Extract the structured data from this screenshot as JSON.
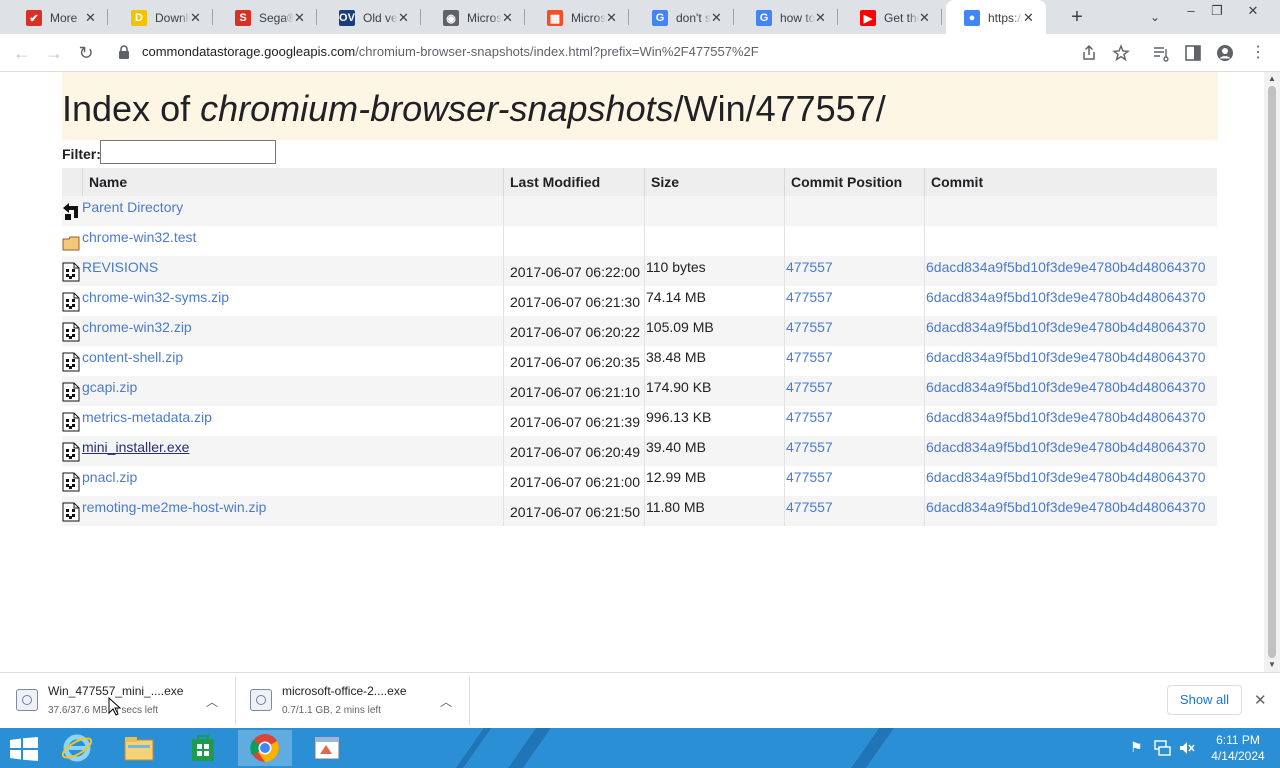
{
  "tabs": [
    {
      "title": "More",
      "favicon_color": "#d93025",
      "favicon_glyph": "✔"
    },
    {
      "title": "Downlo",
      "favicon_color": "#f2c300",
      "favicon_glyph": "D"
    },
    {
      "title": "Sega®",
      "favicon_color": "#d93025",
      "favicon_glyph": "S"
    },
    {
      "title": "Old ver",
      "favicon_color": "#1a3d7c",
      "favicon_glyph": "OV"
    },
    {
      "title": "Micros",
      "favicon_color": "#5f6368",
      "favicon_glyph": "◉"
    },
    {
      "title": "Micros",
      "favicon_color": "#f25022",
      "favicon_glyph": "▦"
    },
    {
      "title": "don't st",
      "favicon_color": "#4285f4",
      "favicon_glyph": "G"
    },
    {
      "title": "how to",
      "favicon_color": "#4285f4",
      "favicon_glyph": "G"
    },
    {
      "title": "Get the",
      "favicon_color": "#ff0000",
      "favicon_glyph": "▶"
    },
    {
      "title": "https://",
      "favicon_color": "#4285f4",
      "favicon_glyph": "●"
    }
  ],
  "window": {
    "minimize": "–",
    "restore": "❐",
    "close": "✕"
  },
  "toolbar": {
    "back": "←",
    "forward": "→",
    "reload": "↻",
    "url_host": "commondatastorage.googleapis.com",
    "url_path": "/chromium-browser-snapshots/index.html?prefix=Win%2F477557%2F"
  },
  "page": {
    "title_prefix": "Index of ",
    "title_italic": "chromium-browser-snapshots",
    "title_suffix": "/Win/477557/",
    "filter_label": "Filter:",
    "filter_value": "",
    "columns": {
      "name": "Name",
      "modified": "Last Modified",
      "size": "Size",
      "position": "Commit Position",
      "commit": "Commit"
    },
    "rows": [
      {
        "icon": "back",
        "name": "Parent Directory",
        "modified": "",
        "size": "",
        "position": "",
        "commit": ""
      },
      {
        "icon": "folder",
        "name": "chrome-win32.test",
        "modified": "",
        "size": "",
        "position": "",
        "commit": ""
      },
      {
        "icon": "binary",
        "name": "REVISIONS",
        "modified": "2017-06-07 06:22:00",
        "size": "110 bytes",
        "position": "477557",
        "commit": "6dacd834a9f5bd10f3de9e4780b4d48064370"
      },
      {
        "icon": "binary",
        "name": "chrome-win32-syms.zip",
        "modified": "2017-06-07 06:21:30",
        "size": "74.14 MB",
        "position": "477557",
        "commit": "6dacd834a9f5bd10f3de9e4780b4d48064370"
      },
      {
        "icon": "binary",
        "name": "chrome-win32.zip",
        "modified": "2017-06-07 06:20:22",
        "size": "105.09 MB",
        "position": "477557",
        "commit": "6dacd834a9f5bd10f3de9e4780b4d48064370"
      },
      {
        "icon": "binary",
        "name": "content-shell.zip",
        "modified": "2017-06-07 06:20:35",
        "size": "38.48 MB",
        "position": "477557",
        "commit": "6dacd834a9f5bd10f3de9e4780b4d48064370"
      },
      {
        "icon": "binary",
        "name": "gcapi.zip",
        "modified": "2017-06-07 06:21:10",
        "size": "174.90 KB",
        "position": "477557",
        "commit": "6dacd834a9f5bd10f3de9e4780b4d48064370"
      },
      {
        "icon": "binary",
        "name": "metrics-metadata.zip",
        "modified": "2017-06-07 06:21:39",
        "size": "996.13 KB",
        "position": "477557",
        "commit": "6dacd834a9f5bd10f3de9e4780b4d48064370"
      },
      {
        "icon": "binary",
        "name": "mini_installer.exe",
        "modified": "2017-06-07 06:20:49",
        "size": "39.40 MB",
        "position": "477557",
        "commit": "6dacd834a9f5bd10f3de9e4780b4d48064370",
        "visited": true
      },
      {
        "icon": "binary",
        "name": "pnacl.zip",
        "modified": "2017-06-07 06:21:00",
        "size": "12.99 MB",
        "position": "477557",
        "commit": "6dacd834a9f5bd10f3de9e4780b4d48064370"
      },
      {
        "icon": "binary",
        "name": "remoting-me2me-host-win.zip",
        "modified": "2017-06-07 06:21:50",
        "size": "11.80 MB",
        "position": "477557",
        "commit": "6dacd834a9f5bd10f3de9e4780b4d48064370"
      }
    ]
  },
  "downloads": {
    "items": [
      {
        "name": "Win_477557_mini_....exe",
        "status": "37.6/37.6 MB, 0 secs left"
      },
      {
        "name": "microsoft-office-2....exe",
        "status": "0.7/1.1 GB, 2 mins left"
      }
    ],
    "show_all": "Show all",
    "close": "✕"
  },
  "taskbar": {
    "clock_time": "6:11 PM",
    "clock_date": "4/14/2024",
    "accent": "#2b8fd6"
  }
}
